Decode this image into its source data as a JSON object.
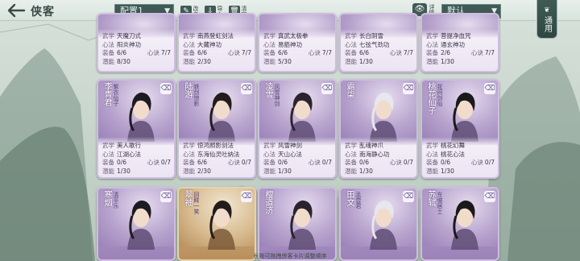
{
  "header": {
    "title": "侠客",
    "config_value": "配置1",
    "tools": [
      {
        "name": "rename",
        "icon": "✎",
        "label": "改名"
      },
      {
        "name": "import",
        "icon": "⇩",
        "label": "导入"
      },
      {
        "name": "clear",
        "icon": "🗑",
        "label": "清空"
      }
    ],
    "detail_label": "详情",
    "sort_value": "默认",
    "use_label": "通用"
  },
  "cards": [
    {
      "name": "",
      "title": "",
      "rows": [
        [
          "武学",
          "天魔刀式",
          "",
          ""
        ],
        [
          "心法",
          "阳炎神功",
          "",
          ""
        ],
        [
          "装备",
          "6/6",
          "心诀",
          "7/7"
        ],
        [
          "潜能",
          "8/30",
          "",
          ""
        ]
      ],
      "style": "purple",
      "broom": false
    },
    {
      "name": "",
      "title": "",
      "rows": [
        [
          "武学",
          "南燕登虹剑法",
          "",
          ""
        ],
        [
          "心法",
          "大藏神功",
          "",
          ""
        ],
        [
          "装备",
          "6/6",
          "心诀",
          "7/7"
        ],
        [
          "潜能",
          "2/30",
          "",
          ""
        ]
      ],
      "style": "purple",
      "broom": false
    },
    {
      "name": "",
      "title": "",
      "rows": [
        [
          "武学",
          "真武太极拳",
          "",
          ""
        ],
        [
          "心法",
          "易筋神功",
          "",
          ""
        ],
        [
          "装备",
          "6/6",
          "心诀",
          "7/7"
        ],
        [
          "潜能",
          "5/30",
          "",
          ""
        ]
      ],
      "style": "purple",
      "broom": false
    },
    {
      "name": "",
      "title": "",
      "rows": [
        [
          "武学",
          "长白阴雪",
          "",
          ""
        ],
        [
          "心法",
          "七弦气劲功",
          "",
          ""
        ],
        [
          "装备",
          "6/6",
          "心诀",
          "7/7"
        ],
        [
          "潜能",
          "1/30",
          "",
          ""
        ]
      ],
      "style": "purple",
      "broom": false
    },
    {
      "name": "",
      "title": "",
      "rows": [
        [
          "武学",
          "菩提净血咒",
          "",
          ""
        ],
        [
          "心法",
          "通玄神功",
          "",
          ""
        ],
        [
          "装备",
          "2/6",
          "心诀",
          "7/7"
        ],
        [
          "潜能",
          "1/30",
          "",
          ""
        ]
      ],
      "style": "purple",
      "broom": false
    },
    {
      "name": "李青君",
      "title": "紫衣仙子",
      "rows": [
        [
          "武学",
          "美人歌行",
          "",
          ""
        ],
        [
          "心法",
          "江湖心法",
          "",
          ""
        ],
        [
          "装备",
          "0/6",
          "心诀",
          "0/7"
        ],
        [
          "潜能",
          "1/30",
          "",
          ""
        ]
      ],
      "style": "purple",
      "broom": true
    },
    {
      "name": "陆游",
      "title": "铁剑惊影",
      "rows": [
        [
          "武学",
          "惊鸿照影剑法",
          "",
          ""
        ],
        [
          "心法",
          "东海仙灵吐纳法",
          "",
          ""
        ],
        [
          "装备",
          "6/6",
          "心诀",
          "0/7"
        ],
        [
          "潜能",
          "2/30",
          "",
          ""
        ]
      ],
      "style": "purple",
      "broom": true
    },
    {
      "name": "凌雪",
      "title": "风雪神剑",
      "rows": [
        [
          "武学",
          "风雪神剑",
          "",
          ""
        ],
        [
          "心法",
          "天山心法",
          "",
          ""
        ],
        [
          "装备",
          "0/6",
          "心诀",
          "0/7"
        ],
        [
          "潜能",
          "1/30",
          "",
          ""
        ]
      ],
      "style": "purple",
      "broom": true
    },
    {
      "name": "霜柒",
      "title": "",
      "rows": [
        [
          "武学",
          "乱魂神爪",
          "",
          ""
        ],
        [
          "心法",
          "南海静心功",
          "",
          ""
        ],
        [
          "装备",
          "0/6",
          "心诀",
          "0/7"
        ],
        [
          "潜能",
          "1/30",
          "",
          ""
        ]
      ],
      "style": "purple",
      "broom": true
    },
    {
      "name": "桃花仙子",
      "title": "花间剑仙",
      "rows": [
        [
          "武学",
          "桃花幻舞",
          "",
          ""
        ],
        [
          "心法",
          "桃花心法",
          "",
          ""
        ],
        [
          "装备",
          "0/6",
          "心诀",
          "0/7"
        ],
        [
          "潜能",
          "1/30",
          "",
          ""
        ]
      ],
      "style": "purple",
      "broom": true
    },
    {
      "name": "寒烟",
      "title": "清平乐",
      "rows": [],
      "style": "purple",
      "broom": true
    },
    {
      "name": "翠袖",
      "title": "回眸一笑",
      "rows": [],
      "style": "gold",
      "broom": true
    },
    {
      "name": "檀道济",
      "title": "",
      "rows": [],
      "style": "purple",
      "broom": false
    },
    {
      "name": "田文",
      "title": "孟尝君",
      "rows": [],
      "style": "purple",
      "broom": true
    },
    {
      "name": "苏轼",
      "title": "东坡居士",
      "rows": [],
      "style": "purple",
      "broom": true
    }
  ],
  "hint": "长按可拖拽侠客卡片调整顺序",
  "colors": {
    "accent": "#3f5a55",
    "card_purple": "#9b82b8",
    "card_gold": "#b98f5d"
  }
}
